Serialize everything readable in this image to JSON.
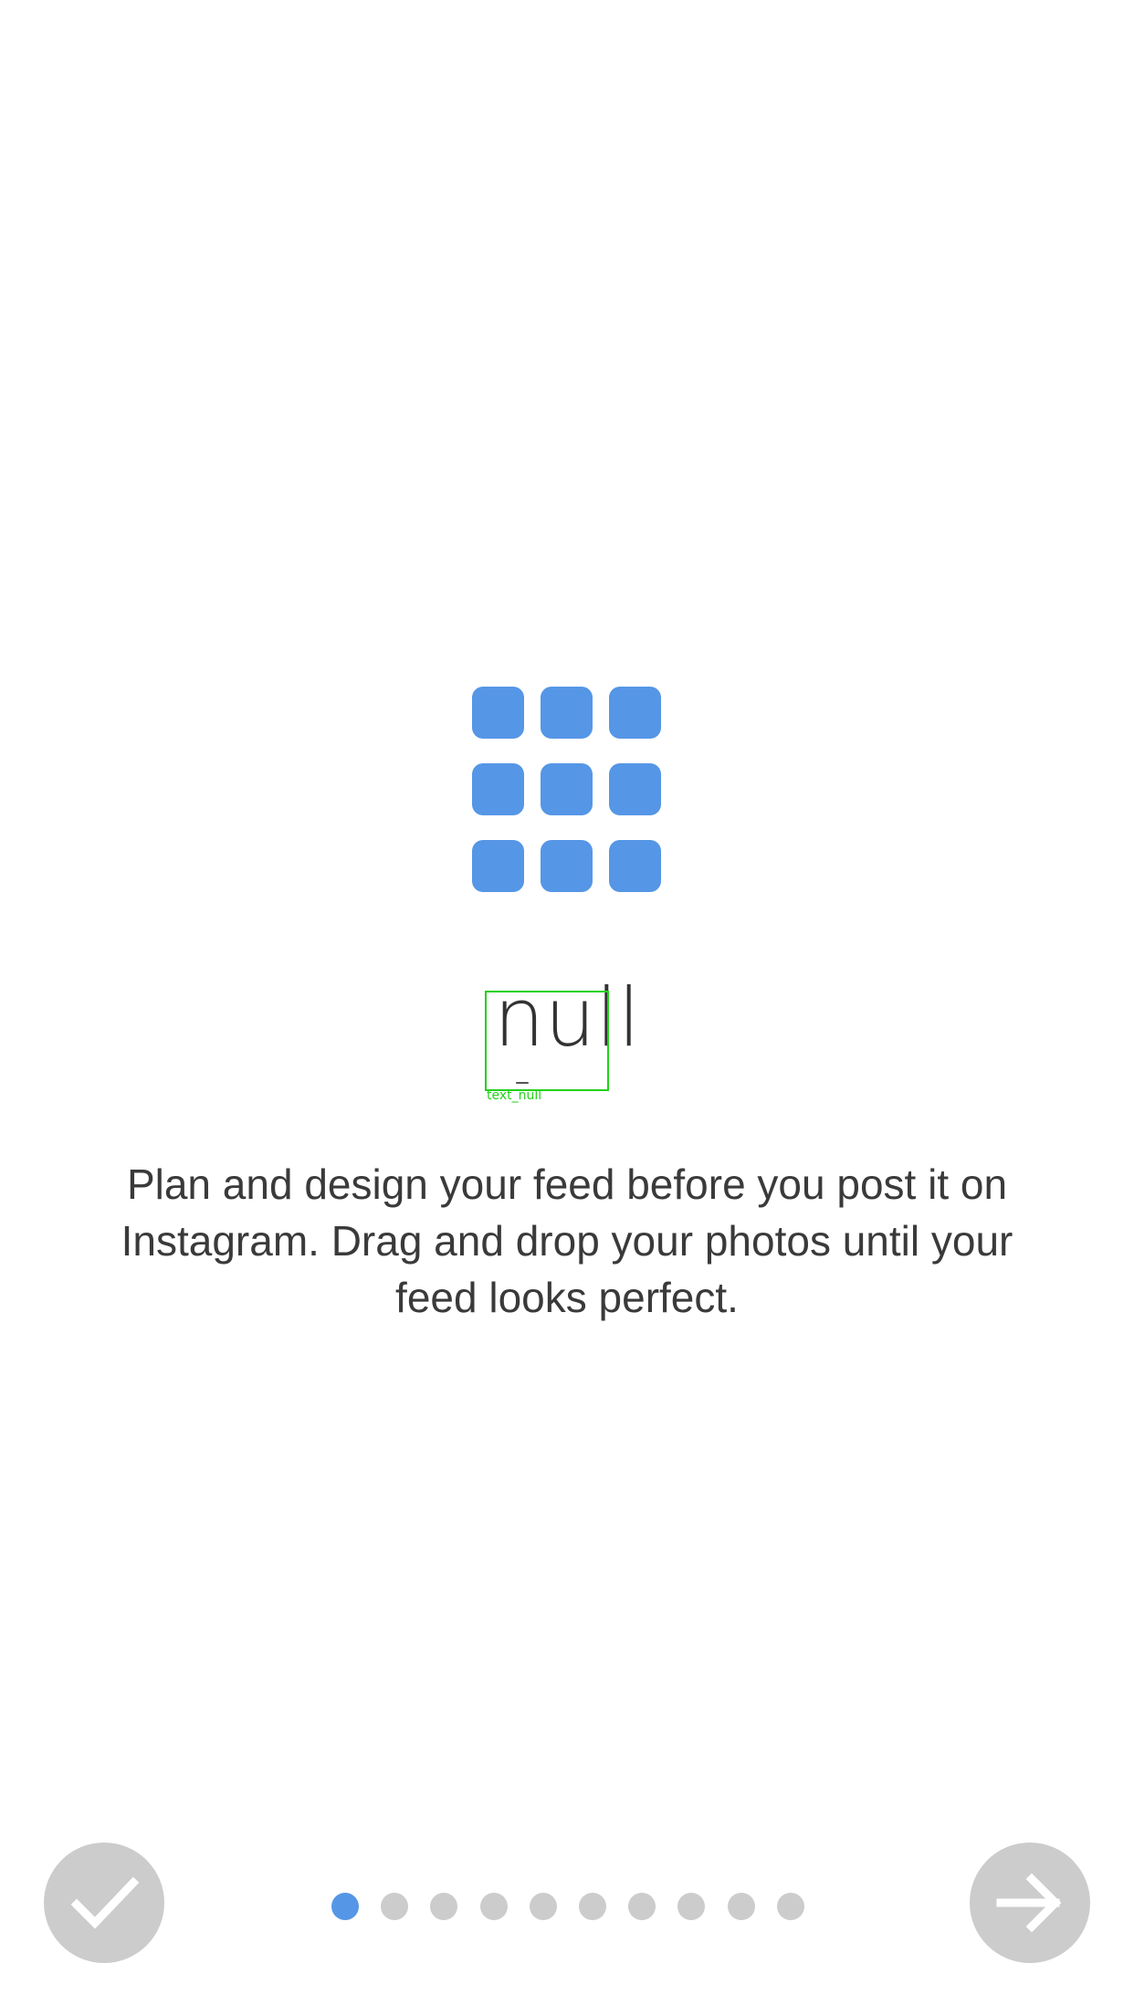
{
  "onboarding": {
    "title": "null",
    "description": "Plan and design your feed before you post it on Instagram. Drag and drop your photos until your feed looks perfect.",
    "debug_label": "text_null",
    "current_page": 1,
    "total_pages": 10
  },
  "buttons": {
    "done_icon": "checkmark-icon",
    "next_icon": "arrow-right-icon"
  },
  "colors": {
    "accent": "#5596e6",
    "inactive_dot": "#cccccc",
    "button_bg": "#cccccc",
    "text": "#333333"
  }
}
